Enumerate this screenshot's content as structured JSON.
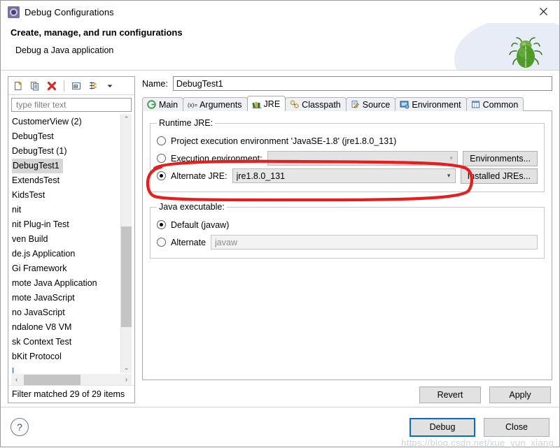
{
  "window": {
    "title": "Debug Configurations",
    "icon": "debug-configurations-icon",
    "close_label": "✕"
  },
  "header": {
    "title": "Create, manage, and run configurations",
    "subtitle": "Debug a Java application",
    "graphic": "green-bug-icon"
  },
  "left_panel": {
    "toolbar": [
      {
        "name": "new-configuration-icon",
        "tooltip": "New launch configuration"
      },
      {
        "name": "duplicate-configuration-icon",
        "tooltip": "Duplicate"
      },
      {
        "name": "delete-configuration-icon",
        "tooltip": "Delete"
      },
      {
        "name": "collapse-all-icon",
        "tooltip": "Collapse All"
      },
      {
        "name": "filter-icon",
        "tooltip": "Filter launch configurations"
      },
      {
        "name": "chevron-down-icon",
        "tooltip": "View menu"
      }
    ],
    "filter": {
      "placeholder": "type filter text",
      "value": ""
    },
    "items": [
      {
        "label": "CustomerView (2)",
        "selected": false,
        "clipped": false
      },
      {
        "label": "DebugTest",
        "selected": false,
        "clipped": false
      },
      {
        "label": "DebugTest (1)",
        "selected": false,
        "clipped": false
      },
      {
        "label": "DebugTest1",
        "selected": true,
        "clipped": false
      },
      {
        "label": "ExtendsTest",
        "selected": false,
        "clipped": false
      },
      {
        "label": "KidsTest",
        "selected": false,
        "clipped": false
      },
      {
        "label": "nit",
        "selected": false,
        "clipped": true
      },
      {
        "label": "nit Plug-in Test",
        "selected": false,
        "clipped": true
      },
      {
        "label": "ven Build",
        "selected": false,
        "clipped": true
      },
      {
        "label": "de.js Application",
        "selected": false,
        "clipped": true
      },
      {
        "label": "Gi Framework",
        "selected": false,
        "clipped": true
      },
      {
        "label": "mote Java Application",
        "selected": false,
        "clipped": true
      },
      {
        "label": "mote JavaScript",
        "selected": false,
        "clipped": true
      },
      {
        "label": "no JavaScript",
        "selected": false,
        "clipped": true
      },
      {
        "label": "ndalone V8 VM",
        "selected": false,
        "clipped": true
      },
      {
        "label": "sk Context Test",
        "selected": false,
        "clipped": true
      },
      {
        "label": "bKit Protocol",
        "selected": false,
        "clipped": true
      },
      {
        "label": "L",
        "selected": false,
        "clipped": true
      }
    ],
    "status": "Filter matched 29 of 29 items",
    "scroll_up": "⌃",
    "scroll_down": "⌄",
    "scroll_left": "‹",
    "scroll_right": "›"
  },
  "main": {
    "name_label": "Name:",
    "name_value": "DebugTest1",
    "tabs": [
      {
        "label": "Main",
        "icon": "main-tab-icon",
        "active": false
      },
      {
        "label": "Arguments",
        "icon": "arguments-tab-icon",
        "active": false
      },
      {
        "label": "JRE",
        "icon": "jre-tab-icon",
        "active": true
      },
      {
        "label": "Classpath",
        "icon": "classpath-tab-icon",
        "active": false
      },
      {
        "label": "Source",
        "icon": "source-tab-icon",
        "active": false
      },
      {
        "label": "Environment",
        "icon": "environment-tab-icon",
        "active": false
      },
      {
        "label": "Common",
        "icon": "common-tab-icon",
        "active": false
      }
    ],
    "runtime_jre": {
      "legend": "Runtime JRE:",
      "option_project": {
        "label": "Project execution environment 'JavaSE-1.8' (jre1.8.0_131)",
        "checked": false
      },
      "option_execution_env": {
        "label": "Execution environment:",
        "checked": false,
        "combo_value": "",
        "button_label": "Environments..."
      },
      "option_alternate": {
        "label": "Alternate JRE:",
        "checked": true,
        "combo_value": "jre1.8.0_131",
        "button_label": "Installed JREs..."
      }
    },
    "java_executable": {
      "legend": "Java executable:",
      "option_default": {
        "label": "Default (javaw)",
        "checked": true
      },
      "option_alternate": {
        "label": "Alternate",
        "checked": false,
        "placeholder": "javaw",
        "value": ""
      }
    },
    "revert_label": "Revert",
    "apply_label": "Apply"
  },
  "footer": {
    "help_label": "?",
    "debug_label": "Debug",
    "close_label": "Close",
    "watermark": "https://blog.csdn.net/xue_yun_xiang"
  },
  "annotation": {
    "type": "red-ellipse-highlight",
    "color": "#e81e1e",
    "target": "alternate-jre-row"
  },
  "colors": {
    "accent_blue": "#0a6cc6",
    "annotation_red": "#e81e1e",
    "selection_gray": "#d6d6d6",
    "bug_green": "#4f9c29"
  }
}
